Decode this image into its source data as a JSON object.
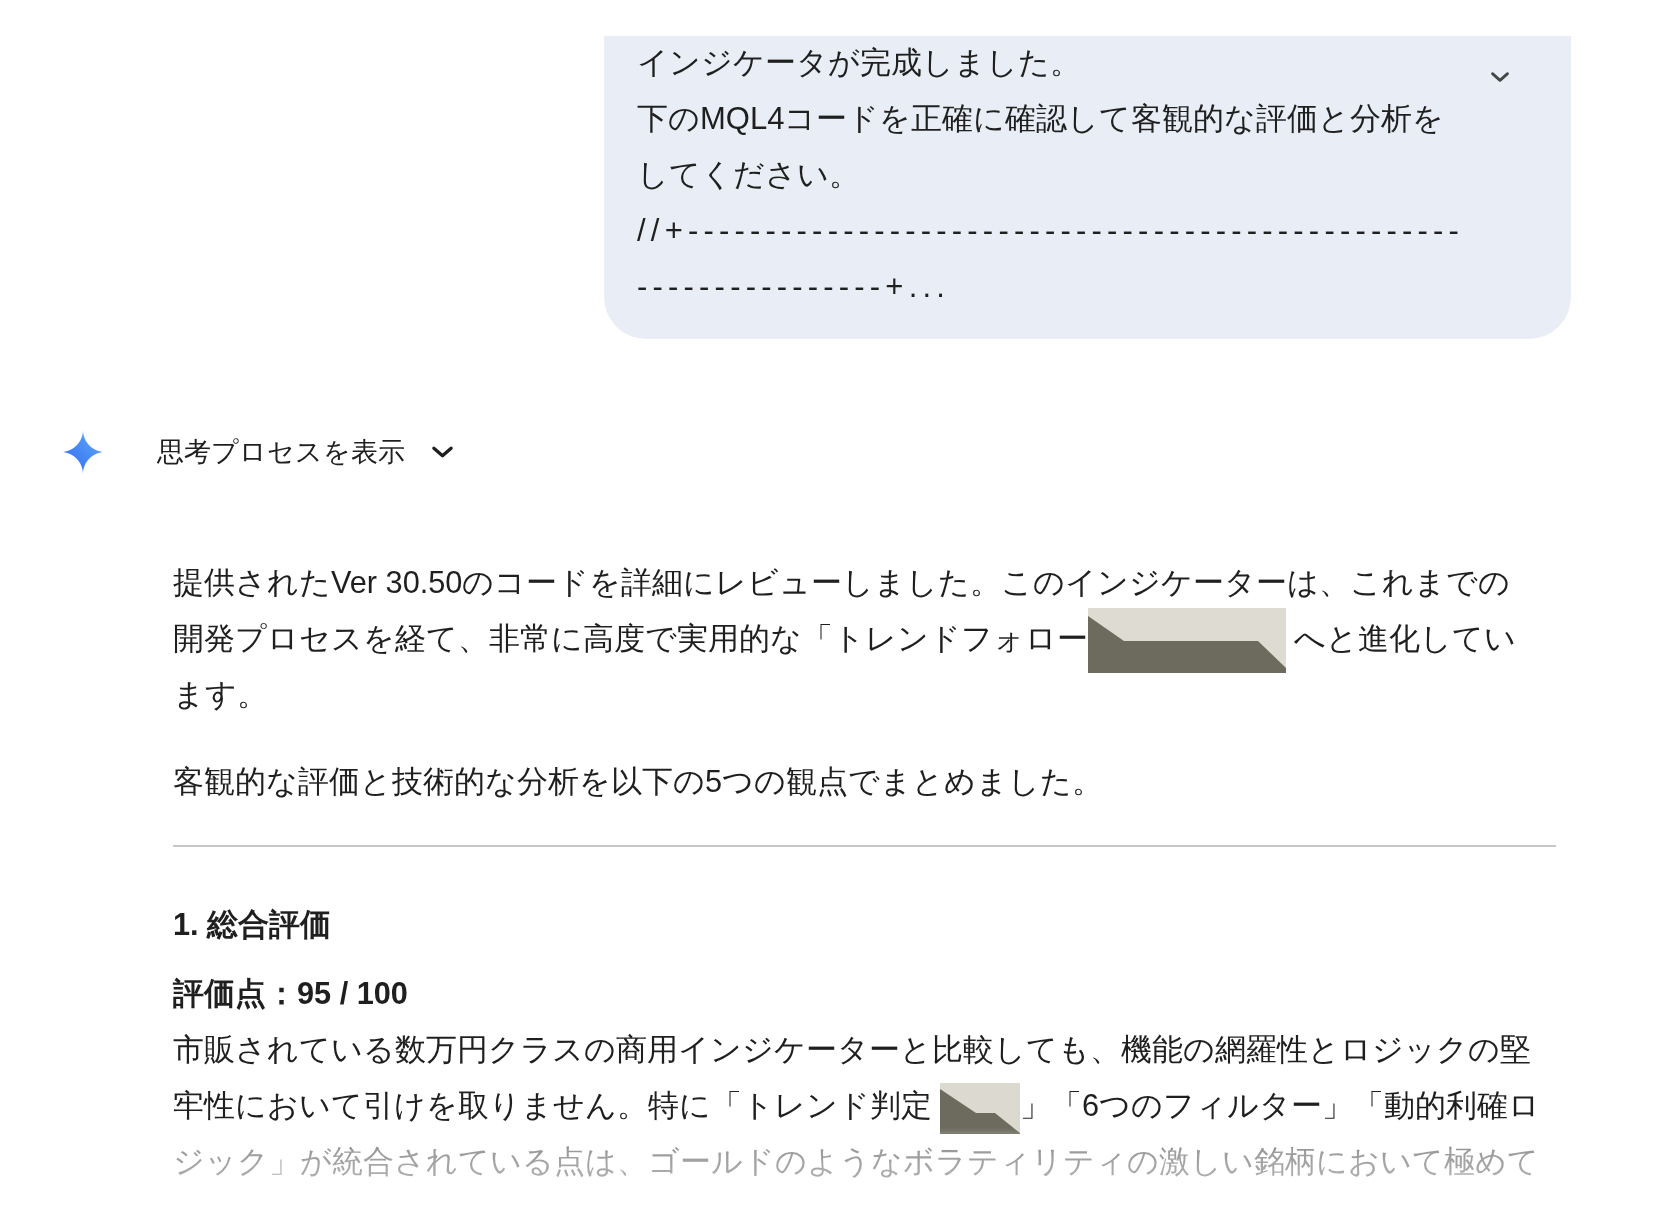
{
  "user_message": {
    "expanded": false,
    "lines": [
      "インジケータが完成しました。",
      "下のMQL4コードを正確に確認して客観的な評価と分析をしてください。"
    ],
    "code": "//+------------------------------------------------------------------+..."
  },
  "thinking_toggle": {
    "label": "思考プロセスを表示",
    "expanded": false
  },
  "response": {
    "intro": [
      {
        "segments": [
          {
            "kind": "text",
            "text": "提供されたVer 30.50のコードを詳細にレビューしました。このインジケーターは、これまでの開発プロセスを経て、非常に高度で実用的な「トレンドフォロー"
          },
          {
            "kind": "strip"
          },
          {
            "kind": "text",
            "text": "へと進化しています。"
          }
        ]
      },
      {
        "segments": [
          {
            "kind": "text",
            "text": "客観的な評価と技術的な分析を以下の5つの観点でまとめました。"
          }
        ]
      }
    ],
    "sections": [
      {
        "heading": "1. 総合評価",
        "score": "評価点：95 / 100",
        "segments": [
          {
            "kind": "text",
            "text": "市販されている数万円クラスの商用インジケーターと比較しても、機能の網羅性とロジックの堅牢性において引けを取りません。特に「トレンド判定"
          },
          {
            "kind": "patch"
          },
          {
            "kind": "text",
            "text": "」「6つのフィルター」「動的利確ロジック」が統合されている点は、ゴールドのようなボラティリティの激しい銘柄において極めて"
          }
        ]
      }
    ]
  }
}
